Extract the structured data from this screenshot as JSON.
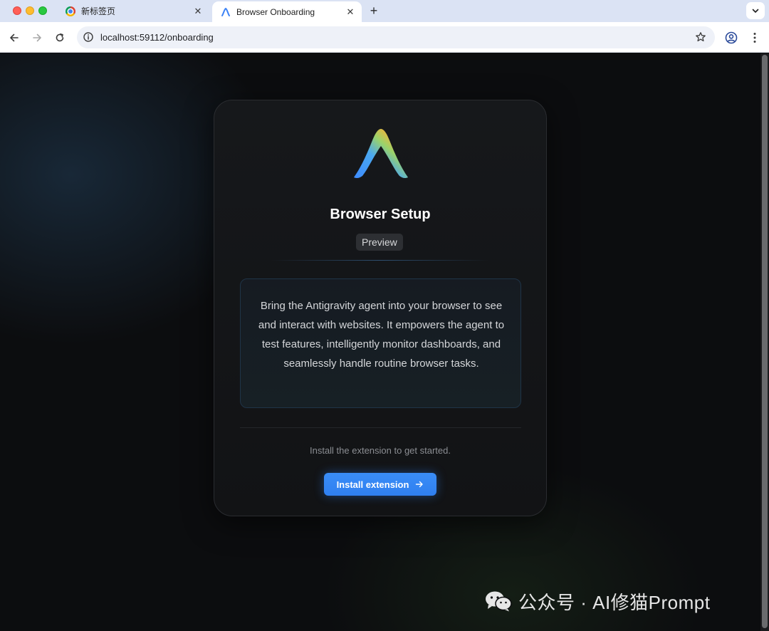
{
  "browser": {
    "tabs": [
      {
        "title": "新标签页",
        "favicon": "chrome-icon",
        "active": false
      },
      {
        "title": "Browser Onboarding",
        "favicon": "antigravity-logo-icon",
        "active": true
      }
    ],
    "address_bar": {
      "url": "localhost:59112/onboarding"
    }
  },
  "page": {
    "heading": "Browser Setup",
    "badge": "Preview",
    "description": "Bring the Antigravity agent into your browser to see and interact with websites. It empowers the agent to test features, intelligently monitor dashboards, and seamlessly handle routine browser tasks.",
    "hint": "Install the extension to get started.",
    "install_button": "Install extension"
  },
  "watermark": {
    "text": "公众号 · AI修猫Prompt"
  },
  "colors": {
    "accent": "#2f7ff0",
    "page_background": "#0c0d0f",
    "card_background": "#141619",
    "tabstrip": "#dbe3f4"
  }
}
